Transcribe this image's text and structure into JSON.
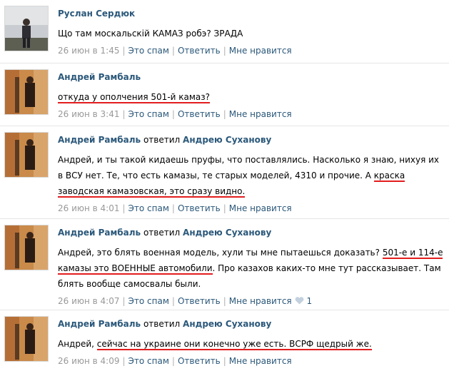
{
  "comments": [
    {
      "author": "Руслан Сердюк",
      "text": "Що там москальскій КАМАЗ робэ? ЗРАДА",
      "date": "26 июн в 1:45",
      "spam": "Это спам",
      "reply": "Ответить",
      "like": "Мне нравится"
    },
    {
      "author": "Андрей Рамбаль",
      "text_u1": "откуда у ополчения 501-й камаз?",
      "date": "26 июн в 3:41",
      "spam": "Это спам",
      "reply": "Ответить",
      "like": "Мне нравится"
    },
    {
      "author": "Андрей Рамбаль",
      "replied": "ответил",
      "to": "Андрею Суханову",
      "text_p1": "Андрей, и ты такой кидаешь пруфы, что поставлялись. Насколько я знаю, нихуя их в ВСУ нет. Те, что есть камазы, те старых моделей, 4310 и прочие. А ",
      "text_u1": "краска заводская камазовская, это сразу видно.",
      "date": "26 июн в 4:01",
      "spam": "Это спам",
      "reply": "Ответить",
      "like": "Мне нравится"
    },
    {
      "author": "Андрей Рамбаль",
      "replied": "ответил",
      "to": "Андрею Суханову",
      "text_p1": "Андрей, это блять военная модель, хули ты мне пытаешься доказать? ",
      "text_u1": "501-е и 114-е камазы это ВОЕННЫЕ автомобили",
      "text_p2": ". Про казахов каких-то мне тут рассказывает. Там блять вообще самосвалы были.",
      "date": "26 июн в 4:07",
      "spam": "Это спам",
      "reply": "Ответить",
      "like": "Мне нравится",
      "likes_count": "1"
    },
    {
      "author": "Андрей Рамбаль",
      "replied": "ответил",
      "to": "Андрею Суханову",
      "text_p1": "Андрей, ",
      "text_u1": "сейчас на украине они конечно уже есть. ВСРФ щедрый же.",
      "date": "26 июн в 4:09",
      "spam": "Это спам",
      "reply": "Ответить",
      "like": "Мне нравится"
    }
  ],
  "colors": {
    "link": "#2b587a",
    "meta": "#999999",
    "underline": "#e31d1d",
    "divider": "#e6e6e6"
  }
}
